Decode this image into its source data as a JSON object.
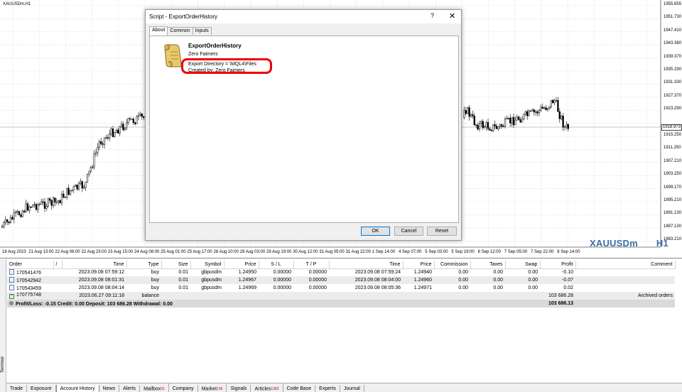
{
  "chart": {
    "symbol_title": "XAUUSDm,H1",
    "watermark_symbol": "XAUUSDm",
    "watermark_tf": "H1",
    "current_price": "1918.973",
    "price_labels": [
      "1955.655",
      "1951.730",
      "1947.410",
      "1943.380",
      "1939.370",
      "1935.290",
      "1931.330",
      "1927.370",
      "1923.290",
      "1918.973",
      "1915.250",
      "1911.250",
      "1907.210",
      "1903.250",
      "1899.170",
      "1895.210",
      "1891.130",
      "1887.130",
      "1883.210"
    ],
    "time_labels": [
      "18 Aug 2023",
      "21 Aug 13:00",
      "22 Aug 06:00",
      "22 Aug 23:00",
      "23 Aug 15:00",
      "24 Aug 08:00",
      "25 Aug 01:00",
      "25 Aug 17:00",
      "28 Aug 10:00",
      "29 Aug 03:00",
      "29 Aug 19:00",
      "30 Aug 12:00",
      "31 Aug 05:00",
      "31 Aug 22:00",
      "1 Sep 14:00",
      "4 Sep 07:00",
      "5 Sep 03:00",
      "5 Sep 19:00",
      "6 Sep 12:00",
      "7 Sep 05:00",
      "7 Sep 22:00",
      "8 Sep 14:00"
    ]
  },
  "dialog": {
    "title": "Script - ExportOrderHistory",
    "help": "?",
    "close": "✕",
    "tabs": [
      "About",
      "Common",
      "Inputs"
    ],
    "script_name": "ExportOrderHistory",
    "author": "Zero Faimers",
    "export_dir": "Export Directory  =  \\MQL4\\Files",
    "created_by": "Created by: Zero Faimers",
    "ok": "OK",
    "cancel": "Cancel",
    "reset": "Reset"
  },
  "terminal": {
    "side_label": "Terminal",
    "headers": [
      "Order",
      "/",
      "Time",
      "Type",
      "Size",
      "Symbol",
      "Price",
      "S / L",
      "T / P",
      "Time",
      "Price",
      "Commission",
      "Taxes",
      "Swap",
      "Profit",
      "Comment"
    ],
    "rows": [
      [
        "170541476",
        "2023.09.08 07:59:12",
        "buy",
        "0.01",
        "gbpusdm",
        "1.24950",
        "0.00000",
        "0.00000",
        "2023.09.08 07:59:24",
        "1.24940",
        "0.00",
        "0.00",
        "0.00",
        "-0.10",
        ""
      ],
      [
        "170542942",
        "2023.09.08 08:01:31",
        "buy",
        "0.01",
        "gbpusdm",
        "1.24967",
        "0.00000",
        "0.00000",
        "2023.09.08 08:04:00",
        "1.24960",
        "0.00",
        "0.00",
        "0.00",
        "-0.07",
        ""
      ],
      [
        "170543459",
        "2023.09.08 08:04:14",
        "buy",
        "0.01",
        "gbpusdm",
        "1.24969",
        "0.00000",
        "0.00000",
        "2023.09.08 08:05:36",
        "1.24971",
        "0.00",
        "0.00",
        "0.00",
        "0.02",
        ""
      ]
    ],
    "balance_row": {
      "order": "170775748",
      "time": "2023.06.27 09:11:18",
      "type": "balance",
      "profit": "103 686.28",
      "comment": "Archived orders"
    },
    "summary": "Profit/Loss: -0.15  Credit: 0.00  Deposit: 103 686.28  Withdrawal: 0.00",
    "summary_total": "103 686.13",
    "tabs": [
      {
        "label": "Trade",
        "badge": ""
      },
      {
        "label": "Exposure",
        "badge": ""
      },
      {
        "label": "Account History",
        "badge": ""
      },
      {
        "label": "News",
        "badge": ""
      },
      {
        "label": "Alerts",
        "badge": ""
      },
      {
        "label": "Mailbox",
        "badge": "91"
      },
      {
        "label": "Company",
        "badge": ""
      },
      {
        "label": "Market",
        "badge": "136"
      },
      {
        "label": "Signals",
        "badge": ""
      },
      {
        "label": "Articles",
        "badge": "1383"
      },
      {
        "label": "Code Base",
        "badge": ""
      },
      {
        "label": "Experts",
        "badge": ""
      },
      {
        "label": "Journal",
        "badge": ""
      }
    ],
    "active_tab": 2
  }
}
